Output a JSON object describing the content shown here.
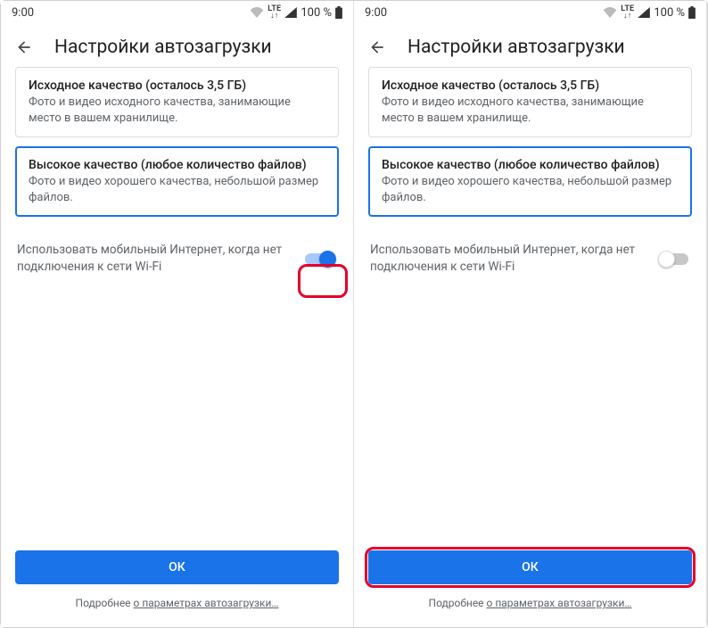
{
  "status": {
    "time": "9:00",
    "battery": "100 %"
  },
  "header": {
    "title": "Настройки автозагрузки"
  },
  "options": {
    "original": {
      "title": "Исходное качество (осталось 3,5 ГБ)",
      "desc": "Фото и видео исходного качества, занимающие место в вашем хранилище."
    },
    "high": {
      "title": "Высокое качество (любое количество файлов)",
      "desc": "Фото и видео хорошего качества, небольшой размер файлов."
    }
  },
  "toggle": {
    "label": "Использовать мобильный Интернет, когда нет подключения к сети Wi-Fi"
  },
  "ok": "ОК",
  "footer": {
    "prefix": "Подробнее ",
    "link": "о параметрах автозагрузки…"
  },
  "colors": {
    "accent": "#1a73e8",
    "highlight": "#e4002b"
  }
}
